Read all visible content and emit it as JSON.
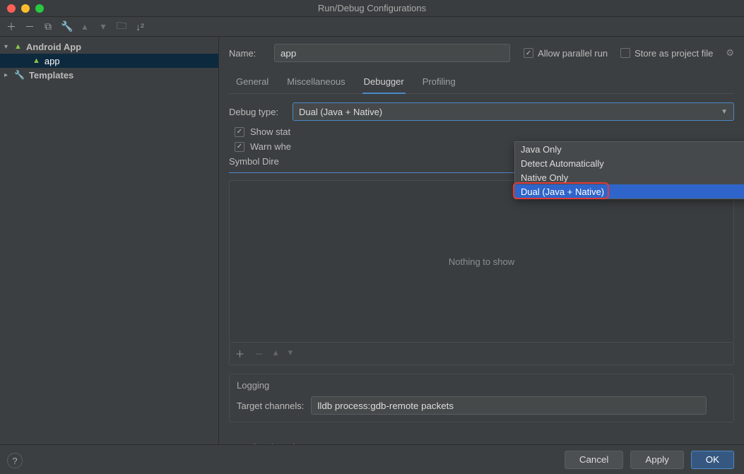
{
  "window": {
    "title": "Run/Debug Configurations"
  },
  "sidebar": {
    "items": [
      {
        "label": "Android App"
      },
      {
        "label": "app"
      },
      {
        "label": "Templates"
      }
    ]
  },
  "header": {
    "name_label": "Name:",
    "name_value": "app",
    "allow_parallel_label": "Allow parallel run",
    "store_label": "Store as project file"
  },
  "tabs": [
    "General",
    "Miscellaneous",
    "Debugger",
    "Profiling"
  ],
  "active_tab": "Debugger",
  "debugger": {
    "debug_type_label": "Debug type:",
    "debug_type_value": "Dual (Java + Native)",
    "options": [
      "Java Only",
      "Detect Automatically",
      "Native Only",
      "Dual (Java + Native)"
    ],
    "show_static_label": "Show stat",
    "warn_label": "Warn whe",
    "symbol_label": "Symbol Dire",
    "symbol_empty": "Nothing to show"
  },
  "logging": {
    "title": "Logging",
    "target_label": "Target channels:",
    "target_value": "lldb process:gdb-remote packets"
  },
  "before_launch": {
    "label": "Before launch"
  },
  "buttons": {
    "cancel": "Cancel",
    "apply": "Apply",
    "ok": "OK"
  }
}
